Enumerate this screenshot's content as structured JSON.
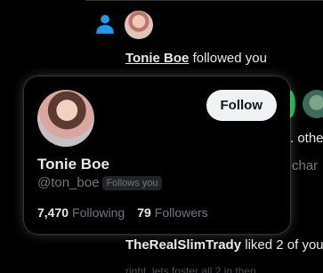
{
  "notification": {
    "icon": "person-icon",
    "actor_name": "Tonie Boe",
    "action_text": "followed you",
    "accent_color": "#1d9bf0"
  },
  "background": {
    "snippet_other": ". othe",
    "snippet_char": "char",
    "row2_name": "TheRealSlimTrady",
    "row2_action": "liked 2 of you",
    "row2_faded": "right, lets foster all 2 in then..."
  },
  "hover_card": {
    "display_name": "Tonie Boe",
    "handle": "@ton_boe",
    "follows_you_badge": "Follows you",
    "follow_button_label": "Follow",
    "following_count": "7,470",
    "following_label": "Following",
    "followers_count": "79",
    "followers_label": "Followers"
  }
}
